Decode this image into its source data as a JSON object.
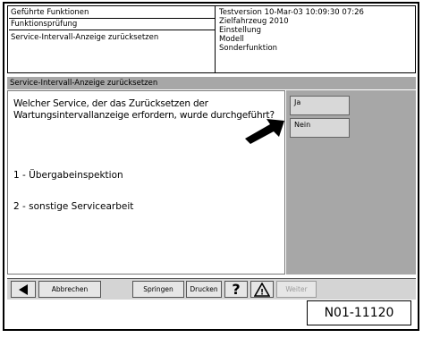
{
  "header": {
    "left": [
      "Geführte Funktionen",
      "Funktionsprüfung",
      "Service-Intervall-Anzeige zurücksetzen"
    ],
    "right": [
      "Testversion 10-Mar-03 10:09:30 07:26",
      "Zielfahrzeug 2010",
      "Einstellung",
      "Modell",
      "Sonderfunktion"
    ]
  },
  "title": "Service-Intervall-Anzeige zurücksetzen",
  "question": "Welcher Service, der das Zurücksetzen der Wartungsintervallanzeige erfordern, wurde durchgeführt?",
  "options": [
    "1 - Übergabeinspektion",
    "2 - sonstige Servicearbeit"
  ],
  "side_buttons": [
    "Ja",
    "Nein"
  ],
  "bottom": {
    "back_label": "Abbrechen",
    "mid1_label": "Springen",
    "mid2_label": "Drucken",
    "help_glyph": "?",
    "warn_glyph": "!",
    "disabled_label": "Weiter"
  },
  "ref_code": "N01-11120"
}
